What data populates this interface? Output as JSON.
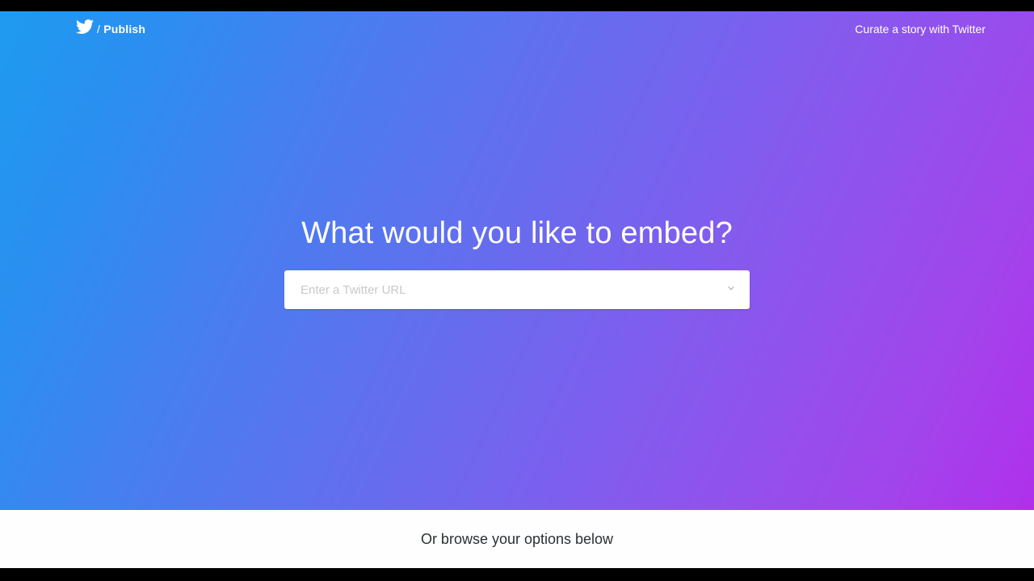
{
  "nav": {
    "brand_separator": "/",
    "brand_label": "Publish",
    "curate_link": "Curate a story with Twitter"
  },
  "hero": {
    "heading": "What would you like to embed?",
    "input_placeholder": "Enter a Twitter URL",
    "input_value": ""
  },
  "below": {
    "text": "Or browse your options below"
  }
}
